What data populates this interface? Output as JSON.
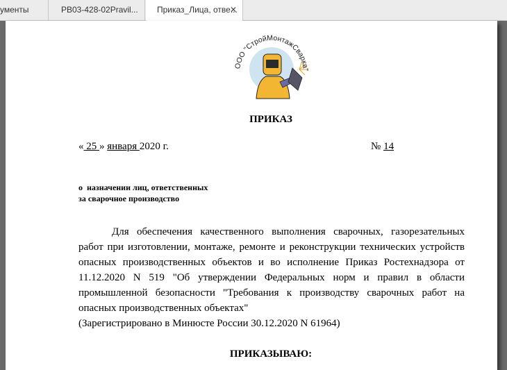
{
  "tabs": [
    {
      "label": "ументы"
    },
    {
      "label": "РВ03-428-02Pravil..."
    },
    {
      "label": "Приказ_Лица, отве...",
      "close": "✕"
    }
  ],
  "logo": {
    "text": "ООО \"СтройМонтажСварка\""
  },
  "document": {
    "title": "ПРИКАЗ",
    "date_open": "«",
    "day": " 25 ",
    "date_mid": "»",
    "month": " января ",
    "year": "2020 г.",
    "number_prefix": "№",
    "number": "14",
    "subject_line1": "о  назначении лиц, ответственных",
    "subject_line2": "за сварочное производство",
    "body_main": "Для обеспечения качественного выполнения сварочных, газорезательных работ при изготовлении, монтаже, ремонте и реконструкции технических устройств опасных производственных объектов и во исполнение Приказ Ростехнадзора от 11.12.2020 N 519 \"Об утверждении Федеральных норм и правил в области промышленной безопасности \"Требования к производству сварочных работ на опасных производственных объектах\"",
    "body_last": "(Зарегистрировано в Минюсте России 30.12.2020 N 61964)",
    "order_word": "ПРИКАЗЫВАЮ:"
  }
}
